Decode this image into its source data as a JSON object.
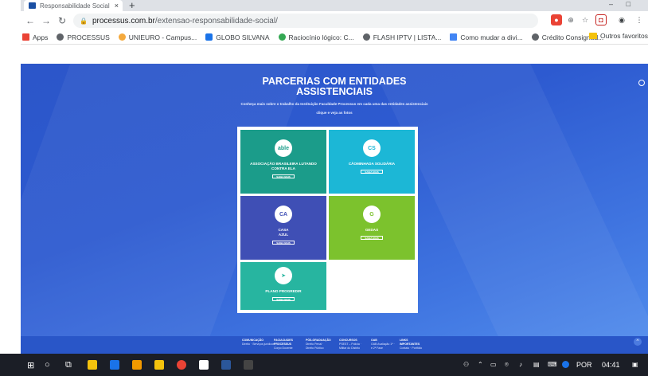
{
  "browser": {
    "tab_title": "Responsabilidade Social - Facult...",
    "tab_close": "×",
    "new_tab": "+",
    "window_min": "–",
    "window_max": "□",
    "url_host": "processus.com.br",
    "url_path": "/extensao-responsabilidade-social/"
  },
  "bookmarks": {
    "items": [
      {
        "label": "Apps",
        "color": "#ea4335"
      },
      {
        "label": "PROCESSUS",
        "color": "#5f6368"
      },
      {
        "label": "UNIEURO - Campus...",
        "color": "#f4a93d"
      },
      {
        "label": "GLOBO SILVANA",
        "color": "#1a73e8"
      },
      {
        "label": "Raciocínio lógico: C...",
        "color": "#34a853"
      },
      {
        "label": "FLASH IPTV | LISTA...",
        "color": "#5f6368"
      },
      {
        "label": "Como mudar a divi...",
        "color": "#4285f4"
      },
      {
        "label": "Crédito Consignad...",
        "color": "#5f6368"
      }
    ],
    "folder": "Outros favoritos"
  },
  "hero": {
    "title_line1": "PARCERIAS COM ENTIDADES",
    "title_line2": "ASSISTENCIAIS",
    "subtitle": "Conheça mais sobre o trabalho da Instituição Faculdade Processus em cada uma das entidades assistenciais",
    "cta": "clique e veja as fotos"
  },
  "cards": [
    {
      "name": "ASSOCIAÇÃO BRASILEIRA LUTANDO CONTRA ELA",
      "logo": "able",
      "button": "SAIBA MAIS",
      "color": "#1b9c8a"
    },
    {
      "name": "CÃOMINHADA SOLIDÁRIA",
      "logo": "CS",
      "button": "SAIBA MAIS",
      "color": "#1cb7d6"
    },
    {
      "name": "CASA AZUL",
      "logo": "CA",
      "button": "SAIBA MAIS",
      "color": "#3f4fb5"
    },
    {
      "name": "GEDAS",
      "logo": "G",
      "button": "SAIBA MAIS",
      "color": "#7cc22d"
    },
    {
      "name": "PLANO PROGREDIR",
      "logo": "➤",
      "button": "SAIBA MAIS",
      "color": "#27b5a0"
    }
  ],
  "footer": {
    "columns": [
      {
        "head": "COMUNICAÇÃO",
        "sub": "Direito · Serviços jurídicos"
      },
      {
        "head": "FACULDADES PROCESSUS",
        "sub": "Corpo Docente"
      },
      {
        "head": "PÓS-GRADUAÇÃO",
        "sub": "Direito Penal · Direito Público"
      },
      {
        "head": "CONCURSOS",
        "sub": "PSEST – Polícia · Militar do Distrito"
      },
      {
        "head": "OAB",
        "sub": "OAB Avaliação 1ª · e 2ª Fase"
      },
      {
        "head": "LINKS IMPORTANTES",
        "sub": "Contato · Portfólio"
      }
    ]
  },
  "taskbar": {
    "lang": "POR",
    "time": "04:41"
  }
}
